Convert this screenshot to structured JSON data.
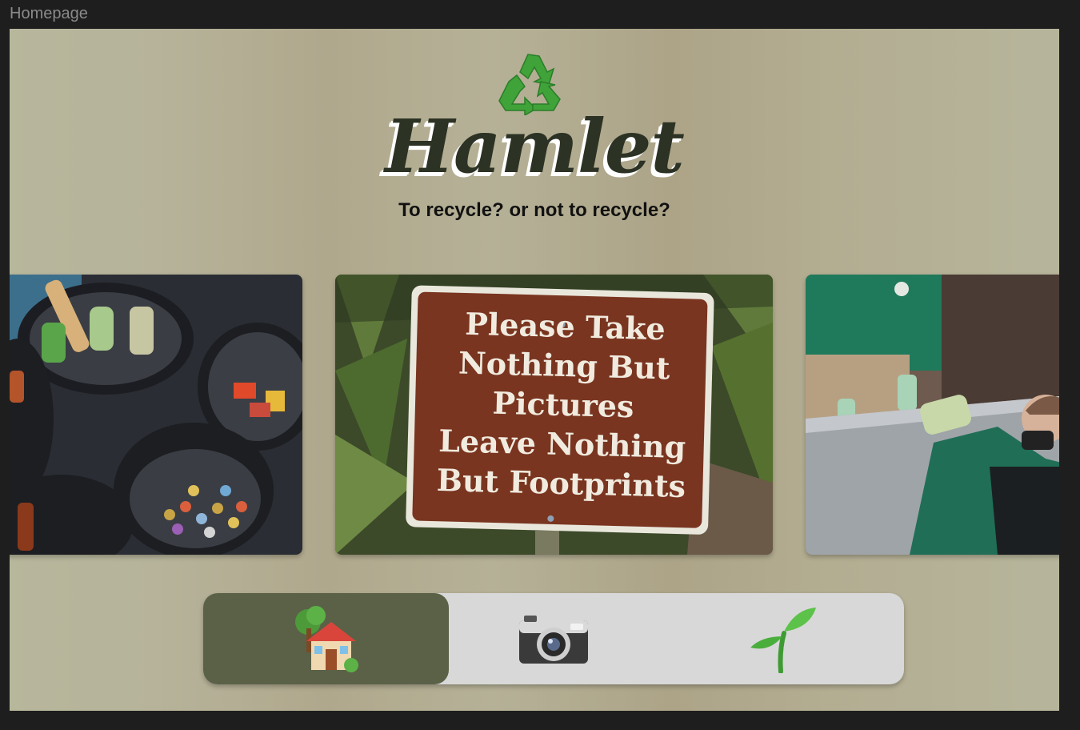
{
  "frame": {
    "label": "Homepage"
  },
  "header": {
    "logo_icon": "recycle-icon",
    "title": "Hamlet",
    "tagline": "To recycle? or not to recycle?"
  },
  "carousel": {
    "items": [
      {
        "id": "recycling-bins",
        "description_icon": "recycling-bins-photo"
      },
      {
        "id": "park-sign",
        "sign_lines": [
          "Please Take",
          "Nothing But",
          "Pictures",
          "Leave Nothing",
          "But Footprints"
        ]
      },
      {
        "id": "volunteers",
        "description_icon": "volunteers-photo"
      }
    ]
  },
  "nav": {
    "active_index": 0,
    "items": [
      {
        "icon": "house-with-tree-icon"
      },
      {
        "icon": "camera-icon"
      },
      {
        "icon": "seedling-icon"
      }
    ]
  },
  "colors": {
    "brand_text": "#2c3324",
    "nav_active": "#5b6146",
    "nav_background": "#d8d8d8",
    "sign_brown": "#7a3520"
  }
}
